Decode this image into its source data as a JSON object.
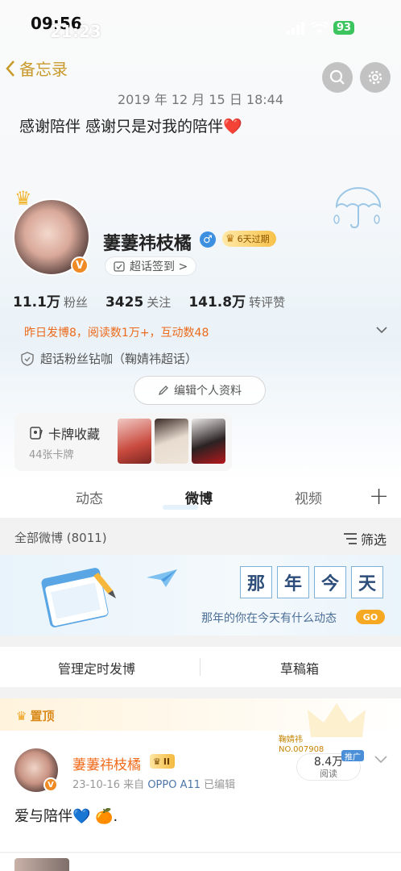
{
  "status_bar": {
    "time_primary": "09:56",
    "time_overlay": "21:23",
    "battery": "93"
  },
  "nav": {
    "back_label": "备忘录"
  },
  "note": {
    "date": "2019 年 12 月 15 日 18:44",
    "text": "感谢陪伴 感谢只是对我的陪伴❤️"
  },
  "profile": {
    "username": "萋萋祎枝橘",
    "vip_text": "6天过期",
    "supertopic_checkin": "超话签到 >",
    "stats": [
      {
        "value": "11.1万",
        "label": "粉丝"
      },
      {
        "value": "3425",
        "label": "关注"
      },
      {
        "value": "141.8万",
        "label": "转评赞"
      }
    ],
    "activity": "昨日发博8，阅读数1万+，互动数48",
    "fan_badge": "超话粉丝钻咖（鞠婧祎超话）",
    "edit_button": "编辑个人资料",
    "cards": {
      "title": "卡牌收藏",
      "count": "44张卡牌"
    }
  },
  "tabs": [
    {
      "label": "动态"
    },
    {
      "label": "微博"
    },
    {
      "label": "视频"
    }
  ],
  "feed_header": {
    "all_label": "全部微博 (8011)",
    "filter_label": "筛选"
  },
  "banner": {
    "chars": [
      "那",
      "年",
      "今",
      "天"
    ],
    "subtitle": "那年的你在今天有什么动态",
    "go_label": "GO"
  },
  "actions": {
    "scheduled": "管理定时发博",
    "drafts": "草稿箱"
  },
  "pinned": {
    "label": "置顶",
    "author": "萋萋祎枝橘",
    "level": "II",
    "date": "23-10-16",
    "source_prefix": "来自",
    "source": "OPPO A11",
    "edited": "已编辑",
    "text": "爱与陪伴💙 🍊.",
    "tag_line1": "鞠婧祎",
    "tag_line2": "NO.007908",
    "reads_value": "8.4万",
    "reads_label": "阅读",
    "promo": "推广"
  },
  "colors": {
    "accent_orange": "#f06a1a",
    "back_gold": "#c89a2b",
    "link_blue": "#4d76a8"
  }
}
